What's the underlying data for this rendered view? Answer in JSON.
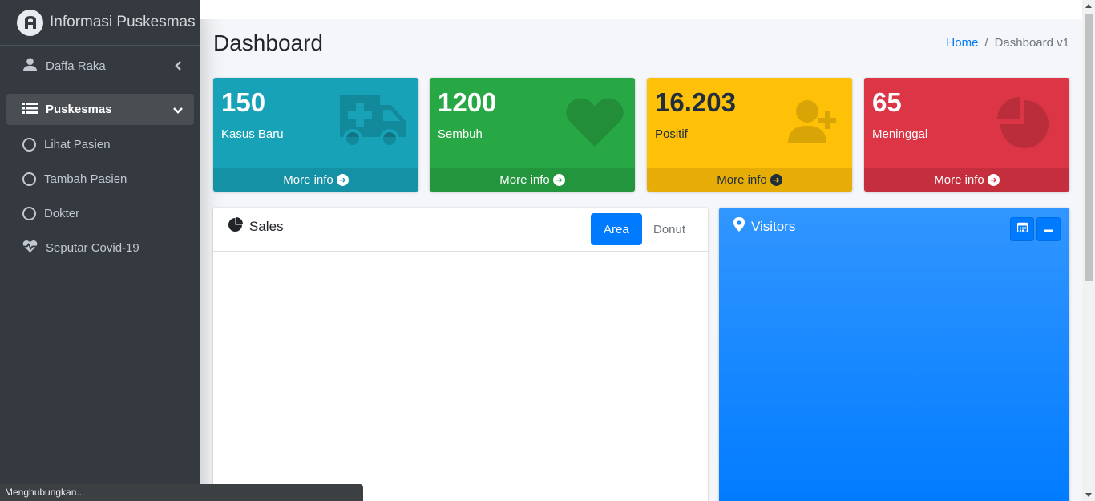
{
  "brand": {
    "title": "Informasi Puskesmas"
  },
  "user": {
    "name": "Daffa Raka"
  },
  "sidebar": {
    "items": [
      {
        "label": "Puskesmas"
      },
      {
        "label": "Lihat Pasien"
      },
      {
        "label": "Tambah Pasien"
      },
      {
        "label": "Dokter"
      },
      {
        "label": "Seputar Covid-19"
      }
    ]
  },
  "header": {
    "title": "Dashboard",
    "breadcrumb": {
      "home": "Home",
      "sep": "/",
      "current": "Dashboard v1"
    }
  },
  "stats": [
    {
      "value": "150",
      "label": "Kasus Baru",
      "footer": "More info",
      "color": "#17a2b8",
      "icon": "ambulance-icon"
    },
    {
      "value": "1200",
      "label": "Sembuh",
      "footer": "More info",
      "color": "#28a745",
      "icon": "heart-icon"
    },
    {
      "value": "16.203",
      "label": "Positif",
      "footer": "More info",
      "color": "#ffc107",
      "icon": "user-plus-icon"
    },
    {
      "value": "65",
      "label": "Meninggal",
      "footer": "More info",
      "color": "#dc3545",
      "icon": "pie-chart-icon"
    }
  ],
  "sales": {
    "title": "Sales",
    "tabs": [
      "Area",
      "Donut"
    ],
    "active_tab": "Area"
  },
  "visitors": {
    "title": "Visitors"
  },
  "status": {
    "text": "Menghubungkan..."
  }
}
